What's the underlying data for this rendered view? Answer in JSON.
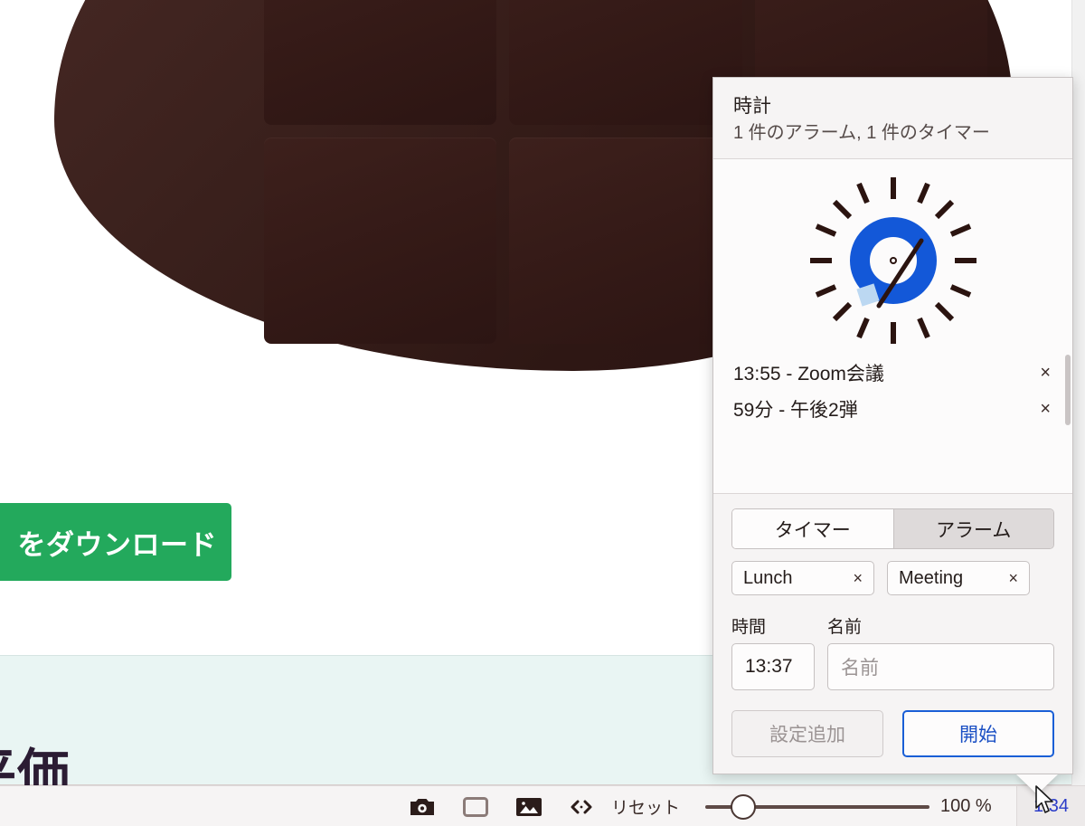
{
  "background": {
    "product_image_alt": "chocolate-bar",
    "download_button_label": "をダウンロード",
    "review_heading": "平価"
  },
  "toolbar": {
    "icons": [
      {
        "name": "camera-icon",
        "label": "camera"
      },
      {
        "name": "rectangle-icon",
        "label": "rectangle"
      },
      {
        "name": "image-icon",
        "label": "image"
      },
      {
        "name": "code-icon",
        "label": "code"
      }
    ],
    "reset_label": "リセット",
    "zoom_value": "100 %",
    "clock_time": "1 34"
  },
  "popup": {
    "title": "時計",
    "subtitle": "1 件のアラーム, 1 件のタイマー",
    "clock_icon": "alarm-clock-icon",
    "events": [
      {
        "label": "13:55 - Zoom会議",
        "close": "×"
      },
      {
        "label": "59分 - 午後2弾",
        "close": "×"
      }
    ],
    "tabs": [
      {
        "label": "タイマー",
        "active": true
      },
      {
        "label": "アラーム",
        "active": false
      }
    ],
    "presets": [
      {
        "label": "Lunch",
        "close": "×"
      },
      {
        "label": "Meeting",
        "close": "×"
      }
    ],
    "fields": {
      "time_label": "時間",
      "time_value": "13:37",
      "name_label": "名前",
      "name_value": "",
      "name_placeholder": "名前"
    },
    "buttons": {
      "add_preset_label": "設定追加",
      "start_label": "開始"
    }
  },
  "colors": {
    "accent_blue": "#1a5fd6",
    "download_green": "#23a95c",
    "review_bg": "#e9f5f3",
    "chocolate_dark": "#2e1714"
  }
}
